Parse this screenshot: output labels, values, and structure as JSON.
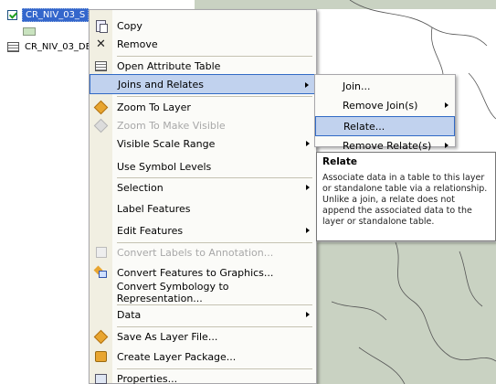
{
  "toc": {
    "selected_layer": "CR_NIV_03_S",
    "table_name": "CR_NIV_03_DE"
  },
  "menu": {
    "items": [
      {
        "label": "Copy",
        "icon": "copy-icon"
      },
      {
        "label": "Remove",
        "icon": "remove-x-icon"
      },
      {
        "label": "Open Attribute Table",
        "icon": "attribute-table-icon"
      },
      {
        "label": "Joins and Relates",
        "icon": "",
        "submenu": true,
        "highlighted": true
      },
      {
        "label": "Zoom To Layer",
        "icon": "zoom-to-layer-icon"
      },
      {
        "label": "Zoom To Make Visible",
        "icon": "zoom-visible-icon",
        "disabled": true
      },
      {
        "label": "Visible Scale Range",
        "icon": "",
        "submenu": true
      },
      {
        "label": "Use Symbol Levels",
        "icon": ""
      },
      {
        "label": "Selection",
        "icon": "",
        "submenu": true
      },
      {
        "label": "Label Features",
        "icon": ""
      },
      {
        "label": "Edit Features",
        "icon": "",
        "submenu": true
      },
      {
        "label": "Convert Labels to Annotation...",
        "icon": "convert-labels-icon",
        "disabled": true
      },
      {
        "label": "Convert Features to Graphics...",
        "icon": "convert-graphics-icon"
      },
      {
        "label": "Convert Symbology to Representation...",
        "icon": ""
      },
      {
        "label": "Data",
        "icon": "",
        "submenu": true
      },
      {
        "label": "Save As Layer File...",
        "icon": "layer-file-icon"
      },
      {
        "label": "Create Layer Package...",
        "icon": "layer-package-icon"
      },
      {
        "label": "Properties...",
        "icon": "properties-icon"
      }
    ]
  },
  "submenu": {
    "items": [
      {
        "label": "Join...",
        "submenu": false
      },
      {
        "label": "Remove Join(s)",
        "submenu": true
      },
      {
        "label": "Relate...",
        "submenu": false,
        "highlighted": true
      },
      {
        "label": "Remove Relate(s)",
        "submenu": true
      }
    ]
  },
  "tooltip": {
    "title": "Relate",
    "body": "Associate data in a table to this layer or standalone table via a relationship. Unlike a join, a relate does not append the associated data to the layer or standalone table."
  },
  "colors": {
    "highlight": "#c1d2ee",
    "highlight_border": "#316ac5",
    "selection": "#3366cc",
    "map_fill": "#c9d2c2"
  }
}
